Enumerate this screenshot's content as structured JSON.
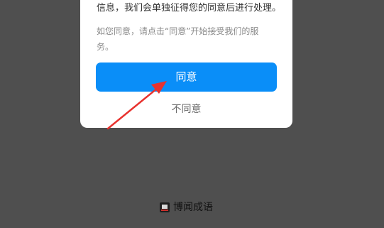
{
  "dialog": {
    "main_text": "信息，我们会单独征得您的同意后进行处理。",
    "sub_text": "如您同意，请点击“同意”开始接受我们的服务。",
    "agree_label": "同意",
    "disagree_label": "不同意"
  },
  "footer": {
    "app_name": "博闻成语",
    "logo_icon": "app-logo"
  },
  "colors": {
    "primary": "#0a8ef8",
    "overlay": "#4f4f4f",
    "annotation_arrow": "#e8322e"
  }
}
